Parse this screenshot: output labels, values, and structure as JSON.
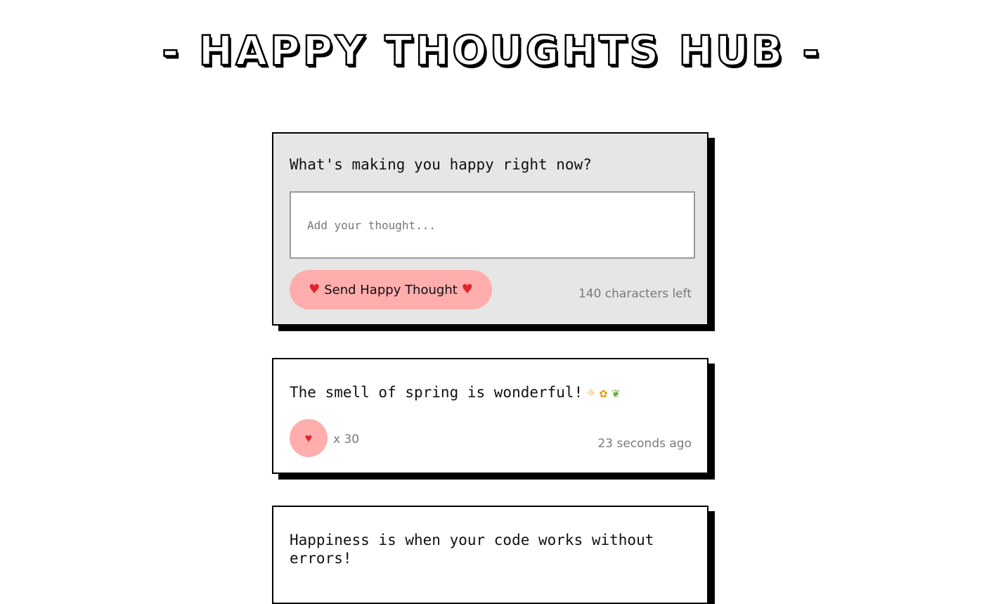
{
  "header": {
    "title": "- HAPPY THOUGHTS HUB -"
  },
  "form": {
    "question": "What's making you happy right now?",
    "input_placeholder": "Add your thought...",
    "input_value": "",
    "send_label": "Send Happy Thought",
    "chars_left": "140 characters left",
    "heart_icon": "heart-icon",
    "accent_color": "#ffadad"
  },
  "thoughts": [
    {
      "text": "The smell of spring is wonderful!",
      "emojis": [
        "☼",
        "✿",
        "❦"
      ],
      "likes": "x 30",
      "time": "23 seconds ago"
    },
    {
      "text": "Happiness is when your code works without errors!"
    }
  ]
}
